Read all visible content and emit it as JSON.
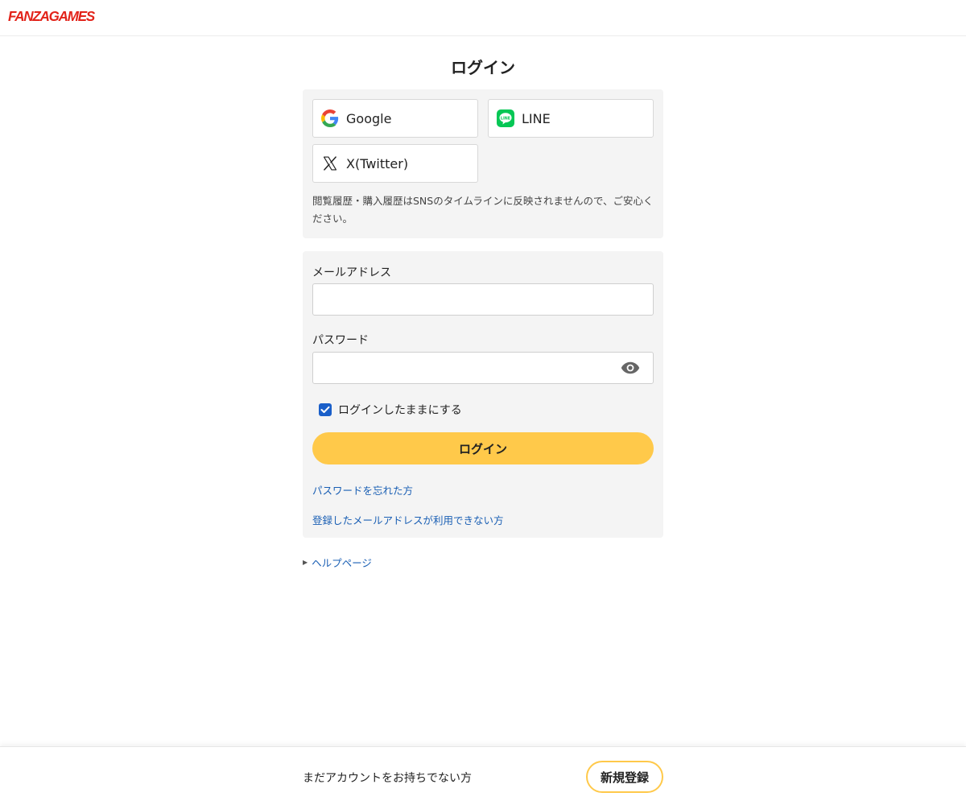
{
  "header": {
    "logo_text": "FANZAGAMES"
  },
  "page": {
    "title": "ログイン"
  },
  "sns": {
    "google_label": "Google",
    "line_label": "LINE",
    "line_icon_text": "LINE",
    "x_label": "X(Twitter)",
    "note": "閲覧履歴・購入履歴はSNSのタイムラインに反映されませんので、ご安心ください。"
  },
  "form": {
    "email_label": "メールアドレス",
    "email_value": "",
    "password_label": "パスワード",
    "password_value": "",
    "keep_logged_in_label": "ログインしたままにする",
    "keep_logged_in_checked": true,
    "login_button": "ログイン",
    "forgot_password_link": "パスワードを忘れた方",
    "cannot_use_email_link": "登録したメールアドレスが利用できない方"
  },
  "help": {
    "link_text": "ヘルプページ"
  },
  "footer": {
    "no_account_text": "まだアカウントをお持ちでない方",
    "register_button": "新規登録"
  },
  "colors": {
    "brand_red": "#e2231a",
    "accent_yellow": "#ffc94a",
    "link_blue": "#1a5fb4",
    "line_green": "#06c755",
    "checkbox_blue": "#1a5fc9"
  },
  "icons": {
    "google": "google-icon",
    "line": "line-icon",
    "x": "x-twitter-icon",
    "eye": "eye-icon",
    "check": "check-icon",
    "triangle": "triangle-right-icon"
  }
}
